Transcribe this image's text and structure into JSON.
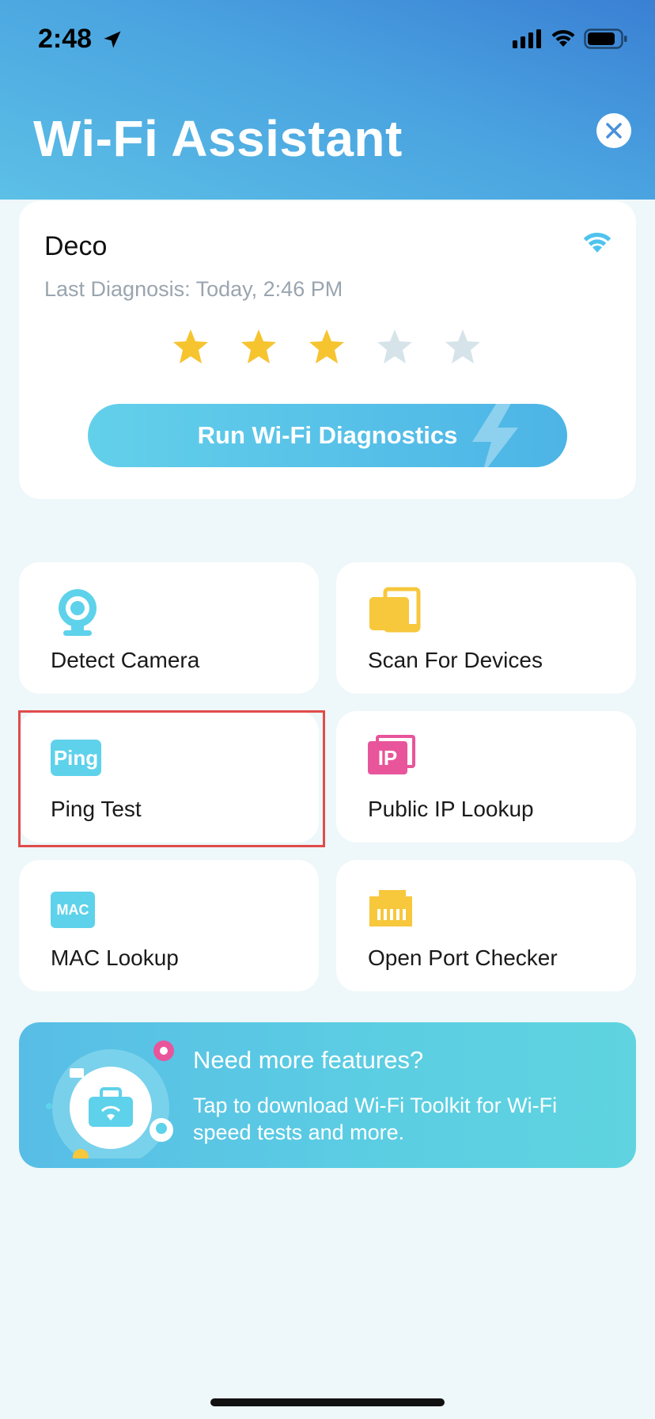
{
  "status_bar": {
    "time": "2:48"
  },
  "header": {
    "title": "Wi-Fi Assistant"
  },
  "network_card": {
    "name": "Deco",
    "last_diagnosis": "Last Diagnosis: Today, 2:46 PM",
    "rating": 3,
    "rating_max": 5,
    "run_button_label": "Run Wi-Fi Diagnostics"
  },
  "tools": [
    {
      "label": "Detect Camera",
      "icon": "camera-icon"
    },
    {
      "label": "Scan For Devices",
      "icon": "devices-icon"
    },
    {
      "label": "Ping Test",
      "icon": "ping-icon",
      "icon_text": "Ping"
    },
    {
      "label": "Public IP Lookup",
      "icon": "ip-icon",
      "icon_text": "IP"
    },
    {
      "label": "MAC Lookup",
      "icon": "mac-icon",
      "icon_text": "MAC"
    },
    {
      "label": "Open Port Checker",
      "icon": "port-icon"
    }
  ],
  "banner": {
    "title": "Need more features?",
    "description": "Tap to download Wi-Fi Toolkit for Wi-Fi speed tests and more."
  },
  "colors": {
    "header_gradient_start": "#3a80d4",
    "header_gradient_end": "#5cc0e6",
    "accent_cyan": "#5ed2ea",
    "star_filled": "#f6c42f",
    "star_empty": "#d6e4ea",
    "device_yellow": "#f7c73c",
    "ip_pink": "#e8559b",
    "highlight_red": "#e14b4b"
  }
}
